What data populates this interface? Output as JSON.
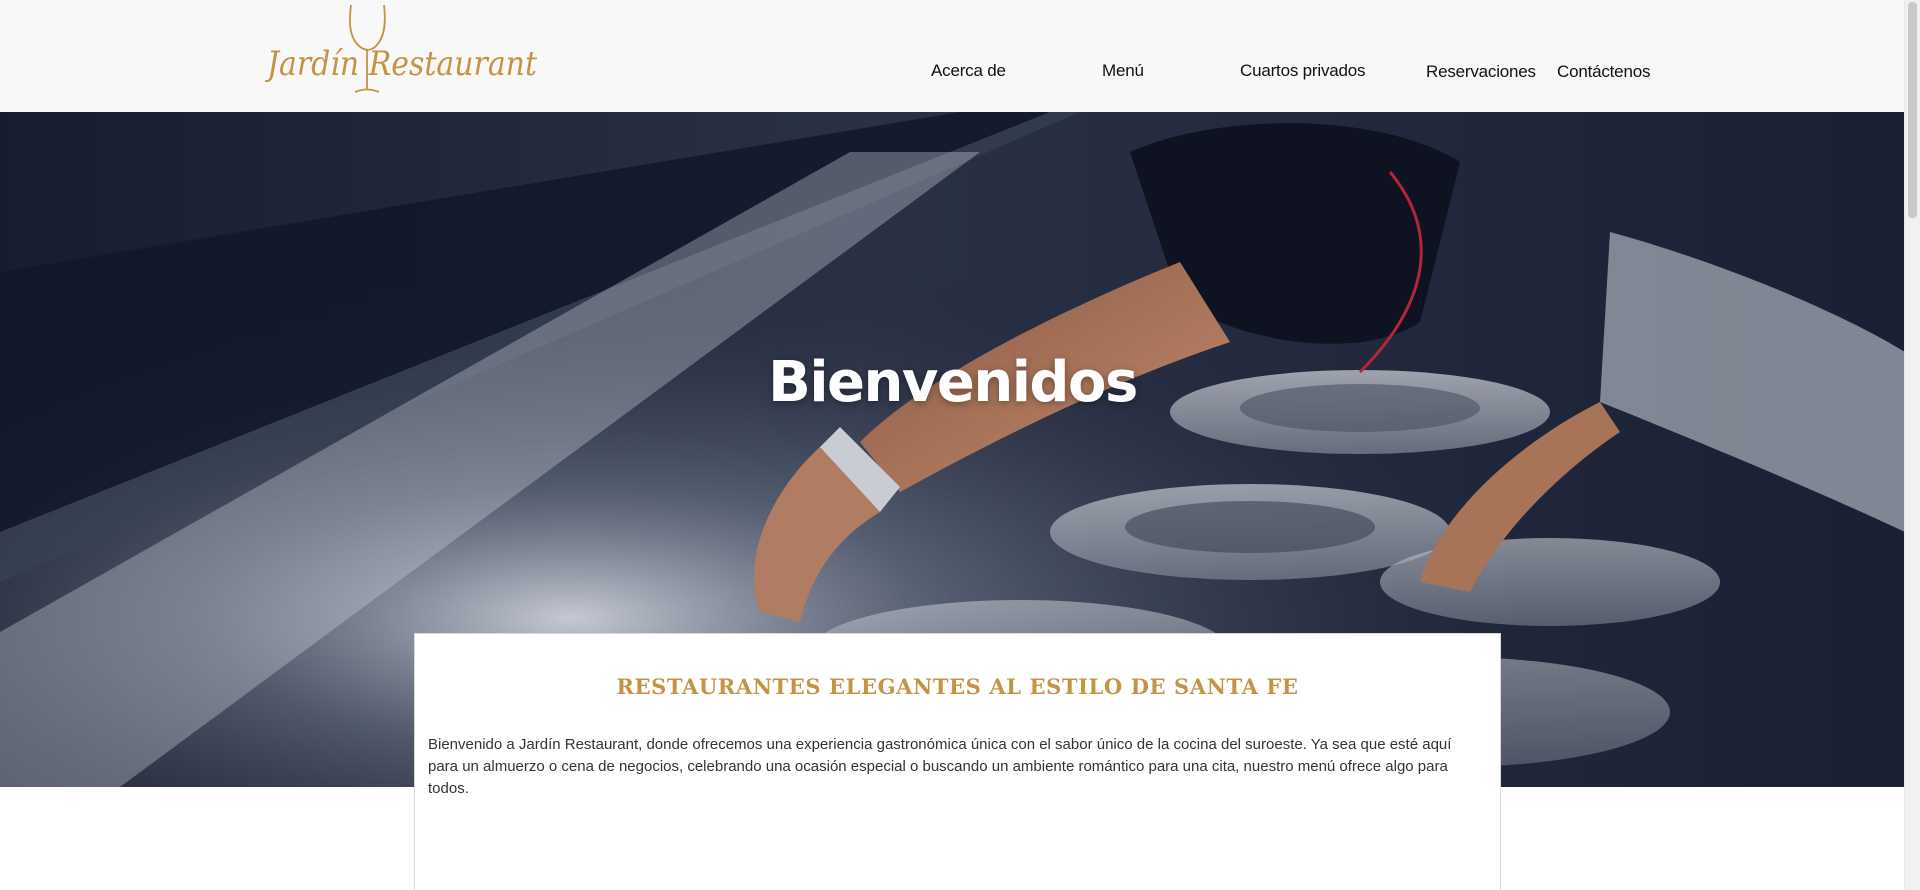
{
  "header": {
    "logo_text": "Jardín Restaurant",
    "nav": [
      {
        "label": "Acerca de"
      },
      {
        "label": "Menú"
      },
      {
        "label": "Cuartos privados"
      },
      {
        "label": "Reservaciones"
      },
      {
        "label": "Contáctenos"
      }
    ]
  },
  "hero": {
    "title": "Bienvenidos"
  },
  "intro": {
    "heading": "RESTAURANTES ELEGANTES AL ESTILO DE SANTA FE",
    "body": "Bienvenido a Jardín Restaurant, donde ofrecemos una experiencia gastronómica única con el sabor único de la cocina del suroeste. Ya sea que esté aquí para un almuerzo o cena de negocios, celebrando una ocasión especial o buscando un ambiente romántico para una cita, nuestro menú ofrece algo para todos."
  },
  "colors": {
    "brand_gold": "#c39446",
    "header_bg": "#f8f8f8",
    "hero_dark": "#1b2236"
  },
  "icons": {
    "logo_glyph": "wine-glass-icon"
  }
}
